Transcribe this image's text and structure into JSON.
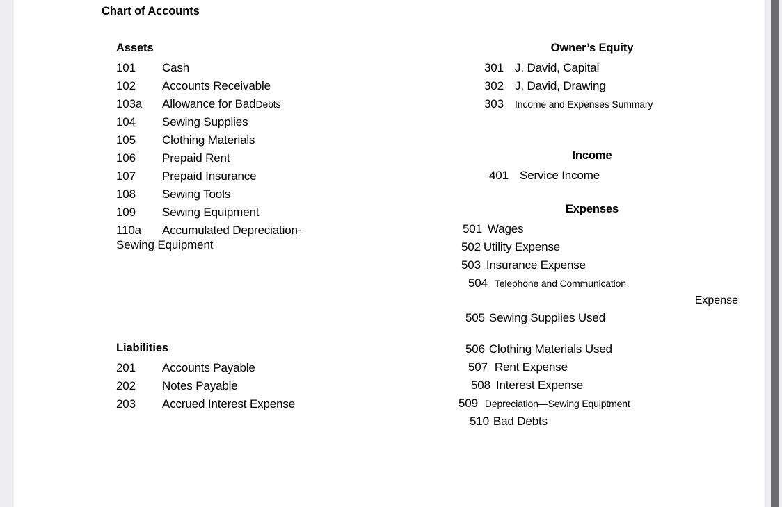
{
  "document": {
    "title": "Chart of Accounts"
  },
  "sections": {
    "assets": {
      "heading": "Assets",
      "rows": [
        {
          "num": "101",
          "name": "Cash"
        },
        {
          "num": "102",
          "name": "Accounts Receivable"
        },
        {
          "num": "103a",
          "name": "Allowance for Bad ",
          "name_small": "Debts"
        },
        {
          "num": "104",
          "name": "Sewing Supplies"
        },
        {
          "num": "105",
          "name": "Clothing Materials"
        },
        {
          "num": "106",
          "name": "Prepaid Rent"
        },
        {
          "num": "107",
          "name": "Prepaid Insurance"
        },
        {
          "num": "108",
          "name": "Sewing Tools"
        },
        {
          "num": "109",
          "name": "Sewing Equipment"
        },
        {
          "num": "110a",
          "name": "Accumulated Depreciation-"
        }
      ],
      "continuation": "Sewing Equipment"
    },
    "liabilities": {
      "heading": "Liabilities",
      "rows": [
        {
          "num": "201",
          "name": "Accounts Payable"
        },
        {
          "num": "202",
          "name": "Notes Payable"
        },
        {
          "num": "203",
          "name": "Accrued Interest Expense"
        }
      ]
    },
    "owners_equity": {
      "heading": "Owner’s Equity",
      "rows": [
        {
          "num": "301",
          "name": "J. David, Capital",
          "small": false
        },
        {
          "num": "302",
          "name": "J. David, Drawing",
          "small": false
        },
        {
          "num": "303",
          "name": "Income and Expenses Summary",
          "small": true
        }
      ]
    },
    "income": {
      "heading": "Income",
      "rows": [
        {
          "num": "401",
          "name": "Service Income",
          "small": false
        }
      ]
    },
    "expenses": {
      "heading": "Expenses",
      "rows_group_one": [
        {
          "num": "501",
          "name": "Wages",
          "small": false,
          "indent": 24,
          "gap": 8
        },
        {
          "num": "502",
          "name": "Utility Expense",
          "small": false,
          "indent": 22,
          "gap": 4
        },
        {
          "num": "503",
          "name": "Insurance Expense",
          "small": false,
          "indent": 22,
          "gap": 8
        },
        {
          "num": "504",
          "name": "Telephone and Communication",
          "small": true,
          "indent": 32,
          "gap": 10
        }
      ],
      "continuation": "Expense",
      "rows_group_two": [
        {
          "num": "505",
          "name": "Sewing Supplies Used",
          "small": false,
          "indent": 28,
          "gap": 6
        }
      ],
      "rows_group_three": [
        {
          "num": "506",
          "name": "Clothing Materials Used",
          "small": false,
          "indent": 28,
          "gap": 6
        },
        {
          "num": "507",
          "name": "Rent Expense",
          "small": false,
          "indent": 32,
          "gap": 10
        },
        {
          "num": "508",
          "name": "Interest Expense",
          "small": false,
          "indent": 36,
          "gap": 8
        },
        {
          "num": "509",
          "name": "Depreciation—Sewing Equiptment",
          "small": true,
          "indent": 18,
          "gap": 10
        },
        {
          "num": "510",
          "name": "Bad Debts",
          "small": false,
          "indent": 34,
          "gap": 6
        }
      ]
    }
  },
  "chrome": {
    "scrollbar_name": "vertical-scrollbar"
  },
  "colors": {
    "page_background": "#ffffff",
    "gutter": "#eeeef2",
    "text": "#000000",
    "scrollbar_thumb": "#6b6b70",
    "scrollbar_track": "#eeeef2"
  }
}
